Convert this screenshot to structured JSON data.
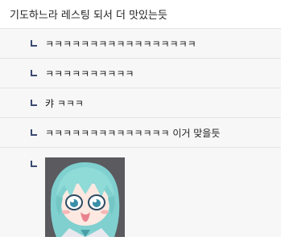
{
  "post": {
    "title": "기도하느라 레스팅 되서 더 맛있는듯"
  },
  "replies": [
    {
      "text": "ㅋㅋㅋㅋㅋㅋㅋㅋㅋㅋㅋㅋㅋㅋㅋㅋㅋ"
    },
    {
      "text": "ㅋㅋㅋㅋㅋㅋㅋㅋㅋㅋ"
    },
    {
      "text": "캬 ㅋㅋㅋ"
    },
    {
      "text": "ㅋㅋㅋㅋㅋㅋㅋㅋㅋㅋㅋㅋㅋㅋ 이거 맞을듯"
    },
    {
      "image": "anime-sticker"
    }
  ]
}
